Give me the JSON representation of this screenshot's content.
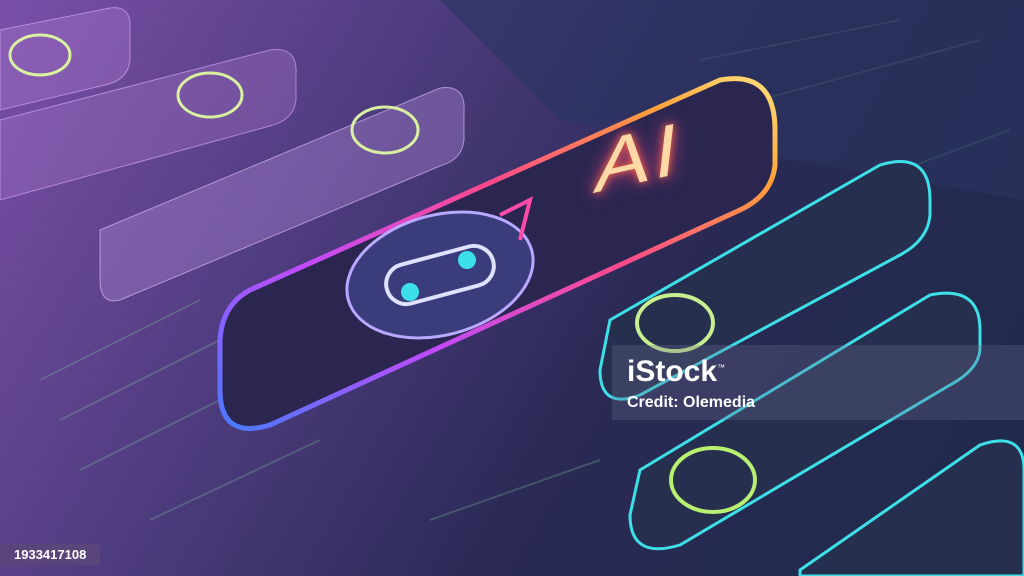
{
  "image": {
    "headline_text": "AI",
    "watermark": {
      "brand": "iStock",
      "trademark": "™",
      "credit": "Credit: Olemedia"
    },
    "image_id": "1933417108"
  },
  "colors": {
    "bg_purple": "#7a4fa8",
    "bg_navy": "#1e2a4a",
    "neon_cyan": "#3ee0e8",
    "neon_pink": "#ff4aa8",
    "neon_orange": "#ffa23a",
    "chat_green": "#b8f070"
  }
}
